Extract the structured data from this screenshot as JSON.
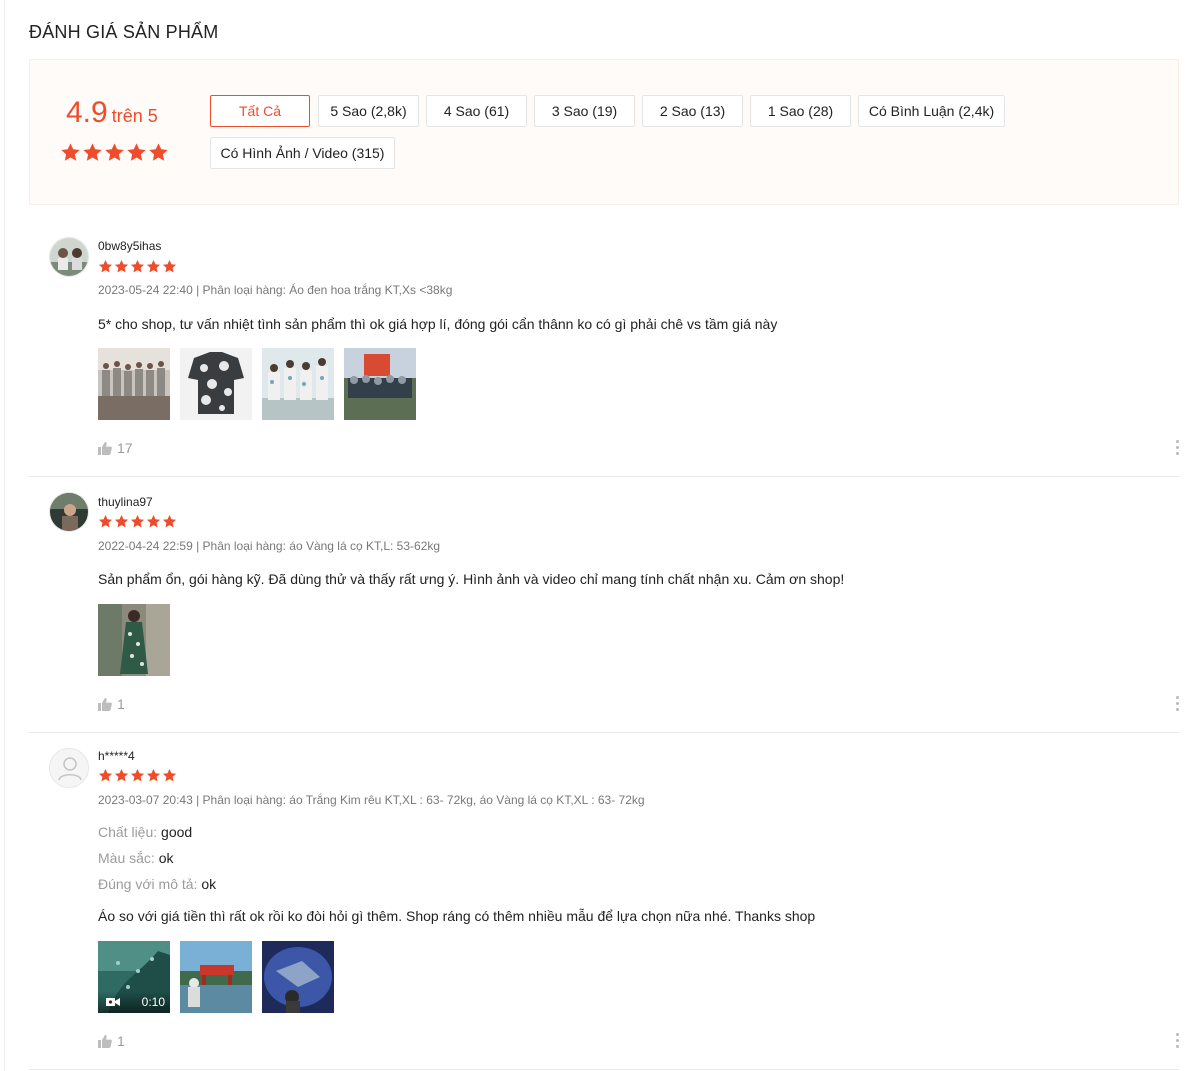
{
  "colors": {
    "accent": "#ee4d2d",
    "muted": "#757575",
    "panel_bg": "#fffbf8"
  },
  "section_title": "ĐÁNH GIÁ SẢN PHẨM",
  "overview": {
    "score": "4.9",
    "score_suffix": "trên 5",
    "rating": 5,
    "filters": [
      {
        "label": "Tất Cả",
        "active": true
      },
      {
        "label": "5 Sao (2,8k)",
        "active": false
      },
      {
        "label": "4 Sao (61)",
        "active": false
      },
      {
        "label": "3 Sao (19)",
        "active": false
      },
      {
        "label": "2 Sao (13)",
        "active": false
      },
      {
        "label": "1 Sao (28)",
        "active": false
      },
      {
        "label": "Có Bình Luận (2,4k)",
        "active": false
      },
      {
        "label": "Có Hình Ảnh / Video (315)",
        "active": false
      }
    ]
  },
  "reviews": [
    {
      "author": "0bw8y5ihas",
      "rating": 5,
      "meta": "2023-05-24 22:40 | Phân loại hàng: Áo đen hoa trắng KT,Xs <38kg",
      "text": "5* cho shop, tư vấn nhiệt tình sản phẩm thì ok giá hợp lí, đóng gói cẩn thânn ko có gì phải chê vs tầm giá này",
      "likes": "17",
      "media": [
        "group-photo",
        "shirt-photo",
        "girls-photo",
        "team-photo"
      ]
    },
    {
      "author": "thuylina97",
      "rating": 5,
      "meta": "2022-04-24 22:59 | Phân loại hàng: áo Vàng lá cọ KT,L: 53-62kg",
      "text": "Sản phẩm ổn, gói hàng kỹ. Đã dùng thử và thấy rất ưng ý. Hình ảnh và video chỉ mang tính chất nhận xu. Cảm ơn shop!",
      "likes": "1",
      "media": [
        "woman-photo"
      ]
    },
    {
      "author": "h*****4",
      "rating": 5,
      "meta": "2023-03-07 20:43 | Phân loại hàng: áo Trắng Kim rêu KT,XL : 63- 72kg, áo Vàng lá cọ KT,XL : 63- 72kg",
      "attributes": [
        {
          "label": "Chất liệu:",
          "value": "good"
        },
        {
          "label": "Màu sắc:",
          "value": "ok"
        },
        {
          "label": "Đúng với mô tả:",
          "value": "ok"
        }
      ],
      "text": "Áo so với giá tiền thì rất ok rồi ko đòi hỏi gì thêm. Shop ráng có thêm nhiều mẫu để lựa chọn nữa nhé. Thanks shop",
      "likes": "1",
      "video_duration": "0:10",
      "media": [
        "aquarium-video",
        "bridge-photo",
        "tunnel-photo"
      ]
    }
  ]
}
